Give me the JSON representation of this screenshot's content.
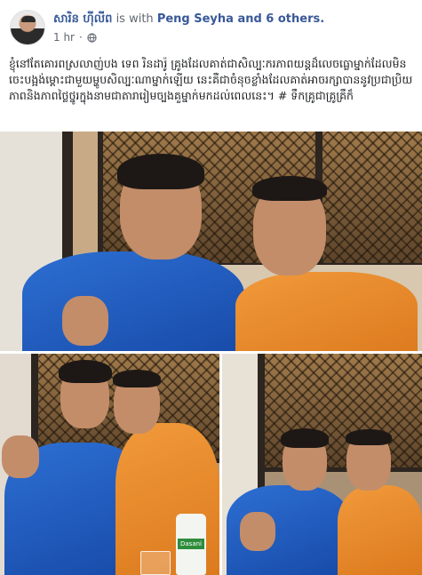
{
  "post": {
    "author": "សារិន ហ៊ីលីព",
    "with_prefix": "is with",
    "with_names": "Peng Seyha and 6 others.",
    "time": "1 hr",
    "privacy_icon": "globe-icon",
    "text": "ខ្ញុំនៅតែគោរពស្រលាញ់បង ទេព រិនដារ៉ូ គ្រូងដែលគាត់ជាសិល្បៈករភាពយន្តដ៏លេចធ្លោម្នាក់ដែលមិនចេះបង្អង់ម្ដោះជាមួយម្ហូបសិល្បៈណាម្នាក់ឡើយ នេះគឺជាចំនុចខ្លាំងដែលគាត់អាចរក្សាបាននូវប្រជាប្រិយភាពនិងភាពថ្លៃថ្នូរក្នុងនាមជាតារារៀមច្បងគួម្នាក់មកដល់ពេលនេះ។ # ទឹកគ្រូជាគ្រូគ្រឹក៏"
  },
  "photos": {
    "bottle_label": "Dasani"
  }
}
